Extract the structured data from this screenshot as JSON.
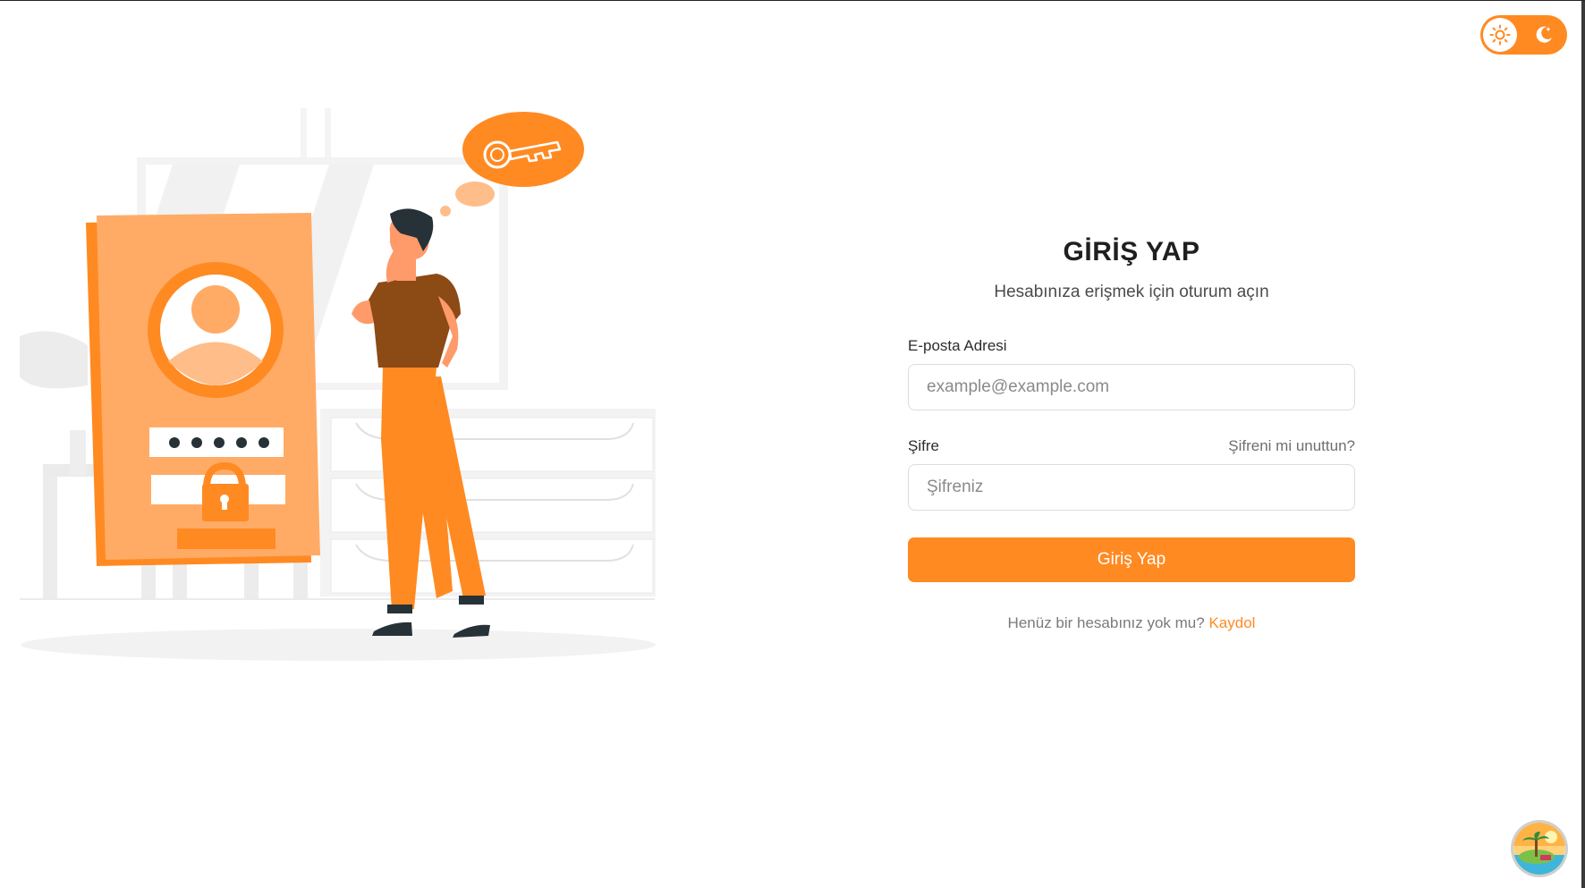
{
  "theme_toggle": {
    "light_icon": "sun-icon",
    "dark_icon": "moon-icon",
    "active": "light",
    "accent_color": "#ff8a22"
  },
  "illustration": {
    "description_icon": "login-illustration",
    "password_dots": "●●●●●"
  },
  "form": {
    "title": "GİRİŞ YAP",
    "subtitle": "Hesabınıza erişmek için oturum açın",
    "email_label": "E-posta Adresi",
    "email_placeholder": "example@example.com",
    "email_value": "",
    "password_label": "Şifre",
    "password_placeholder": "Şifreniz",
    "password_value": "",
    "forgot_link": "Şifreni mi unuttun?",
    "submit_label": "Giriş Yap",
    "signup_prompt": "Henüz bir hesabınız yok mu?",
    "signup_link": "Kaydol"
  },
  "colors": {
    "accent": "#ff8a22",
    "text_primary": "#1f1f1f",
    "text_muted": "#7a7a7a"
  }
}
